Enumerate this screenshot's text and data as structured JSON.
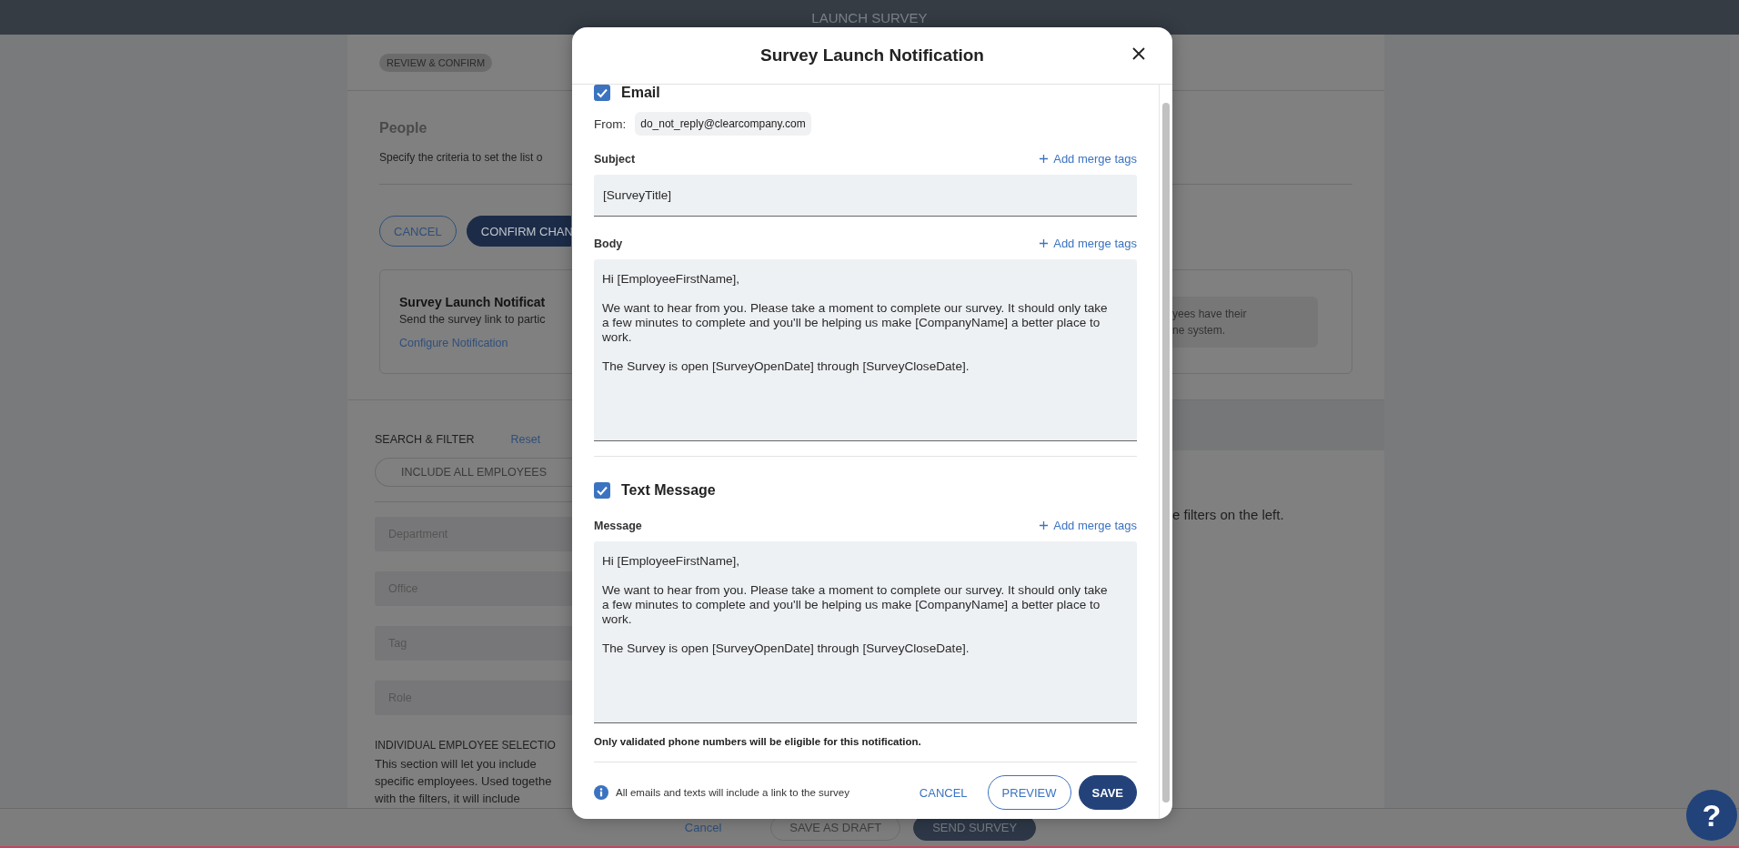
{
  "top_bar": {
    "title": "LAUNCH SURVEY"
  },
  "page": {
    "step_chip": "REVIEW & CONFIRM",
    "people": {
      "title": "People",
      "description": "Specify the criteria to set the list o"
    },
    "buttons": [
      {
        "label": "CANCEL",
        "kind": "outline"
      },
      {
        "label": "CONFIRM CHAN",
        "kind": "filled"
      }
    ],
    "notification_card": {
      "title": "Survey Launch Notificat",
      "description": "Send the survey link to partic",
      "link": "Configure Notification",
      "note_lines": [
        "yees have their",
        "ne system."
      ]
    },
    "search_filter": {
      "title": "SEARCH & FILTER",
      "reset": "Reset",
      "include_all": "INCLUDE ALL EMPLOYEES",
      "fields": [
        {
          "placeholder": "Department"
        },
        {
          "placeholder": "Office"
        },
        {
          "placeholder": "Tag"
        },
        {
          "placeholder": "Role"
        }
      ]
    },
    "individual_selection": {
      "title": "INDIVIDUAL EMPLOYEE SELECTIO",
      "lines": [
        "This section will let you include",
        "specific employees. Used togethe",
        "with the filters, it will include"
      ]
    },
    "results_hint": "e filters on the left."
  },
  "bottom_bar": {
    "buttons": [
      {
        "label": "Cancel",
        "kind": "link"
      },
      {
        "label": "SAVE AS DRAFT",
        "kind": "outline"
      },
      {
        "label": "SEND SURVEY",
        "kind": "filled"
      }
    ],
    "help_button": "?"
  },
  "modal": {
    "title": "Survey Launch Notification",
    "sections": [
      {
        "label": "Email",
        "checked": true,
        "from_label": "From:",
        "from_value": "do_not_reply@clearcompany.com",
        "fields": [
          {
            "label": "Subject",
            "merge_link": "Add merge tags",
            "kind": "single",
            "value": "[SurveyTitle]"
          },
          {
            "label": "Body",
            "merge_link": "Add merge tags",
            "kind": "multi",
            "value": "Hi [EmployeeFirstName],\n\nWe want to hear from you. Please take a moment to complete our survey. It should only take a few minutes to complete and you'll be helping us make [CompanyName] a better place to work.\n\nThe Survey is open [SurveyOpenDate] through [SurveyCloseDate]."
          }
        ]
      },
      {
        "label": "Text Message",
        "checked": true,
        "fields": [
          {
            "label": "Message",
            "merge_link": "Add merge tags",
            "kind": "multi",
            "value": "Hi [EmployeeFirstName],\n\nWe want to hear from you. Please take a moment to complete our survey. It should only take a few minutes to complete and you'll be helping us make [CompanyName] a better place to work.\n\nThe Survey is open [SurveyOpenDate] through [SurveyCloseDate]."
          }
        ],
        "note": "Only validated phone numbers will be eligible for this notification."
      }
    ],
    "footer": {
      "info": "All emails and texts will include a link to the survey",
      "buttons": [
        {
          "label": "CANCEL",
          "kind": "text"
        },
        {
          "label": "PREVIEW",
          "kind": "outline"
        },
        {
          "label": "SAVE",
          "kind": "filled"
        }
      ]
    }
  }
}
